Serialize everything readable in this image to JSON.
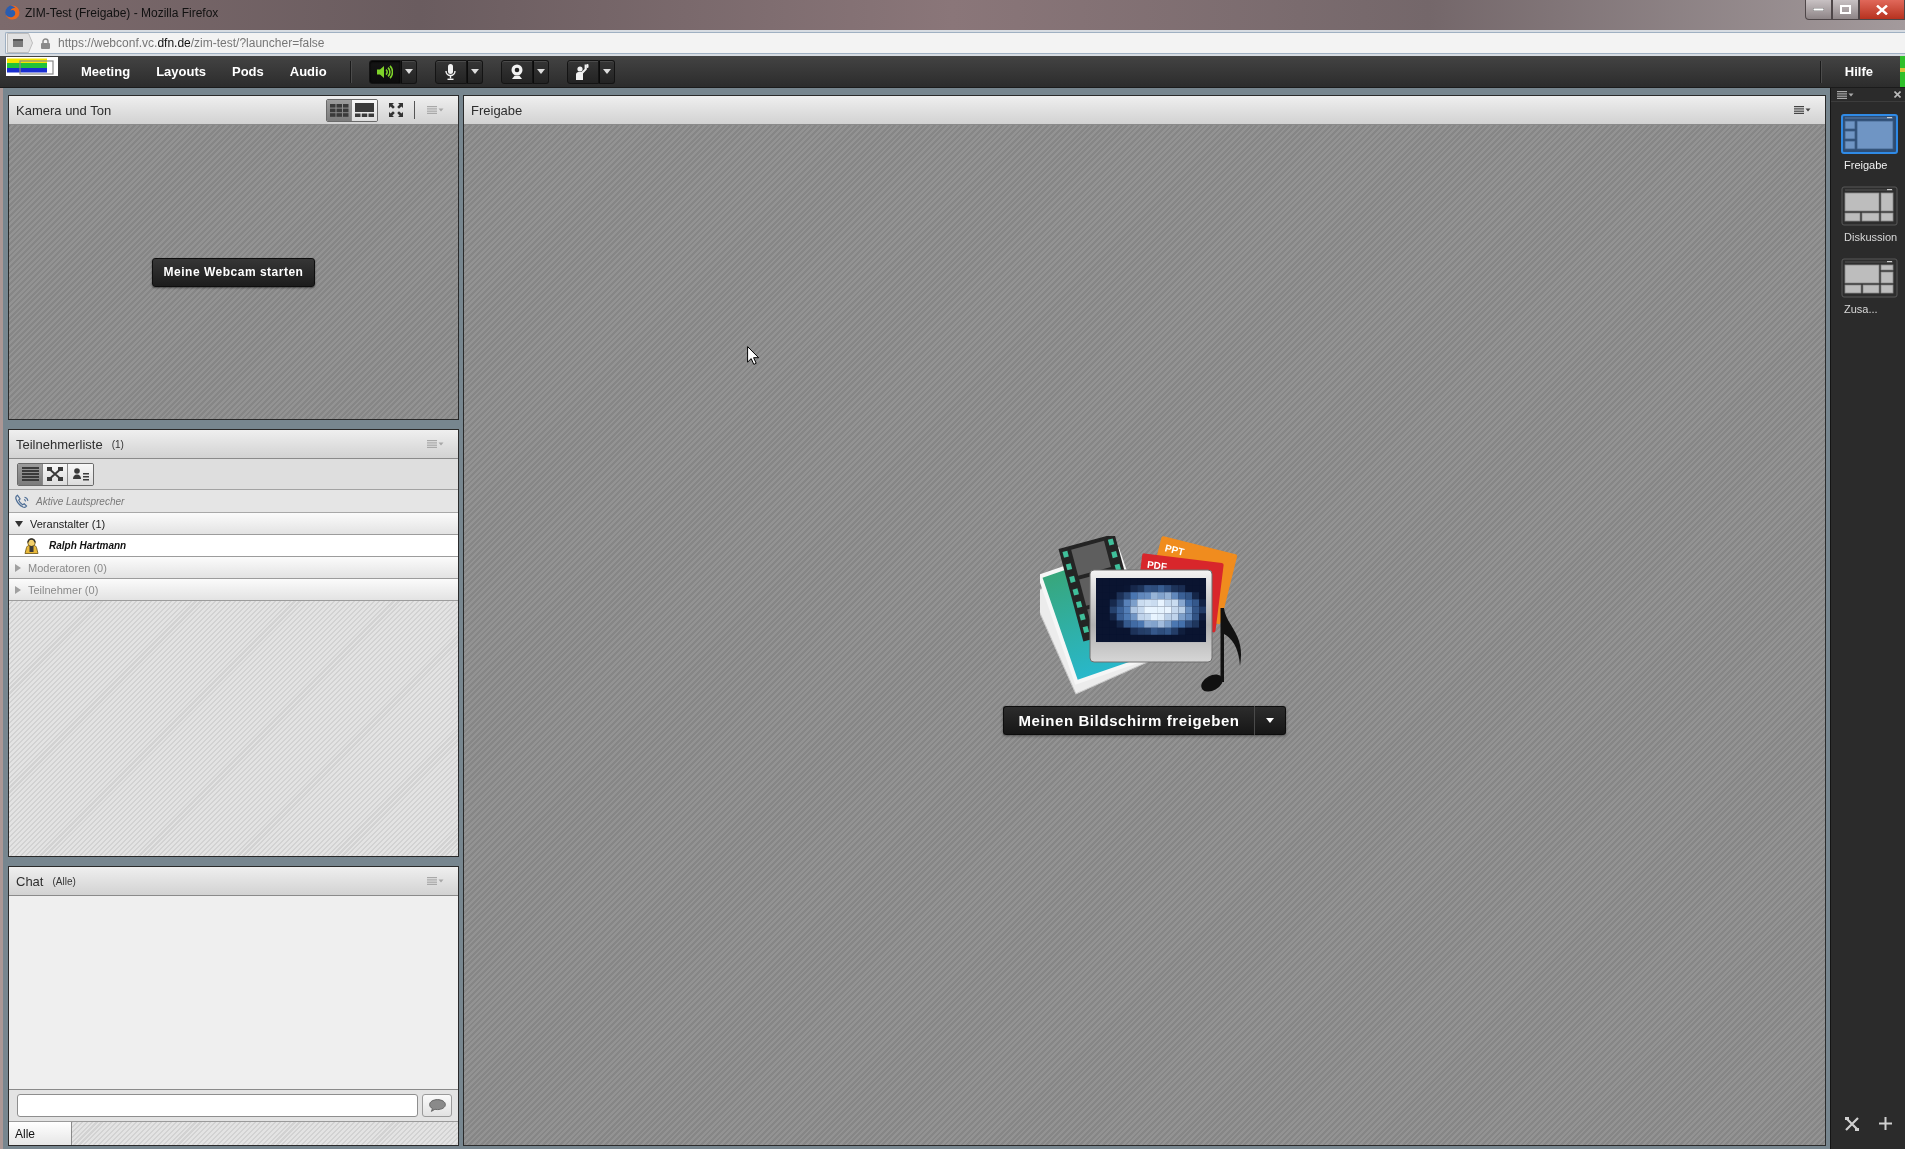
{
  "window": {
    "title": "ZIM-Test (Freigabe) - Mozilla Firefox"
  },
  "address_bar": {
    "url": "https://webconf.vc.**dfn.de**/zim-test/?launcher=false"
  },
  "menu_bar": {
    "items": [
      "Meeting",
      "Layouts",
      "Pods",
      "Audio"
    ],
    "controls": [
      {
        "kind": "speaker",
        "on": true
      },
      {
        "kind": "microphone",
        "on": false
      },
      {
        "kind": "webcam",
        "on": false
      },
      {
        "kind": "raise_hand",
        "on": false
      }
    ],
    "help": "Hilfe"
  },
  "camera_pod": {
    "title": "Kamera und Ton",
    "view_modes": [
      {
        "kind": "grid",
        "selected": true
      },
      {
        "kind": "single",
        "selected": false
      }
    ],
    "start_button": "Meine Webcam starten"
  },
  "attendee_pod": {
    "title": "Teilnehmerliste",
    "count": "(1)",
    "views": [
      {
        "kind": "list",
        "selected": true
      },
      {
        "kind": "breakout",
        "selected": false
      },
      {
        "kind": "attendee",
        "selected": false
      }
    ],
    "active_speakers": "Aktive Lautsprecher",
    "groups": [
      {
        "label": "Veranstalter (1)",
        "expanded": true,
        "disabled": false,
        "children": [
          {
            "name": "Ralph Hartmann"
          }
        ]
      },
      {
        "label": "Moderatoren (0)",
        "expanded": false,
        "disabled": true
      },
      {
        "label": "Teilnehmer (0)",
        "expanded": false,
        "disabled": true
      }
    ]
  },
  "chat_pod": {
    "title": "Chat",
    "scope": "(Alle)",
    "tabs": [
      {
        "label": "Alle",
        "selected": true
      }
    ]
  },
  "share_pod": {
    "title": "Freigabe",
    "illustration_labels": [
      "PPT",
      "PDF"
    ],
    "share_button": "Meinen Bildschirm freigeben"
  },
  "layouts": [
    {
      "kind": "sharing",
      "label": "Freigabe",
      "selected": true
    },
    {
      "kind": "discussion",
      "label": "Diskussion",
      "selected": false
    },
    {
      "kind": "collaboration",
      "label": "Zusa...",
      "selected": false
    }
  ]
}
